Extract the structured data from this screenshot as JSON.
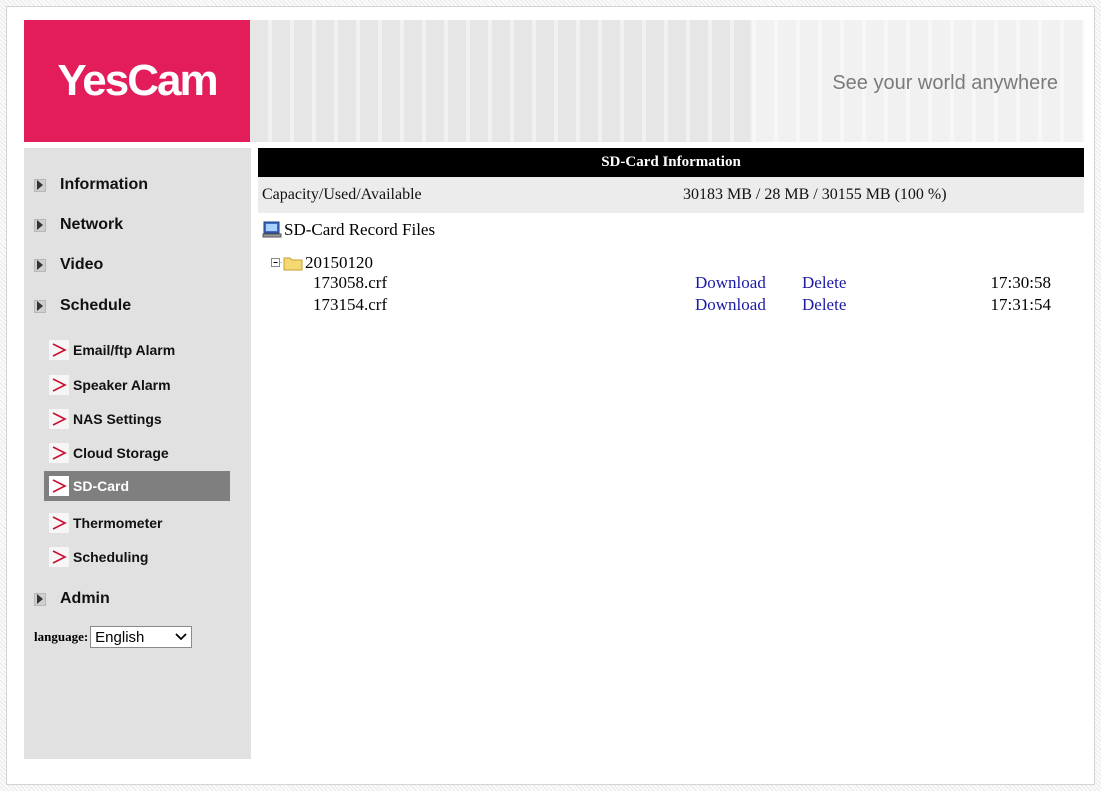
{
  "brand": {
    "logo_text": "YesCam",
    "tagline": "See your world anywhere",
    "accent": "#e31c5a"
  },
  "nav": {
    "items": [
      {
        "label": "Information"
      },
      {
        "label": "Network"
      },
      {
        "label": "Video"
      },
      {
        "label": "Schedule"
      },
      {
        "label": "Admin"
      }
    ],
    "schedule_sub": [
      {
        "label": "Email/ftp Alarm"
      },
      {
        "label": "Speaker Alarm"
      },
      {
        "label": "NAS Settings"
      },
      {
        "label": "Cloud Storage"
      },
      {
        "label": "SD-Card",
        "active": true
      },
      {
        "label": "Thermometer"
      },
      {
        "label": "Scheduling"
      }
    ],
    "active_color": "#7f7f7f"
  },
  "language": {
    "label": "language:",
    "selected": "English"
  },
  "sdcard": {
    "title": "SD-Card Information",
    "capacity_label": "Capacity/Used/Available",
    "capacity_value": "30183 MB / 28 MB / 30155 MB (100 %)",
    "record_files_label": "SD-Card Record Files",
    "folder": "20150120",
    "files": [
      {
        "name": "173058.crf",
        "download": "Download",
        "delete": "Delete",
        "time": "17:30:58"
      },
      {
        "name": "173154.crf",
        "download": "Download",
        "delete": "Delete",
        "time": "17:31:54"
      }
    ]
  },
  "icons": {
    "menu": "triangle-right-icon",
    "submenu": "chevron-right-icon",
    "record": "monitor-icon",
    "folder": "folder-icon",
    "tree": "tree-collapse-icon"
  }
}
